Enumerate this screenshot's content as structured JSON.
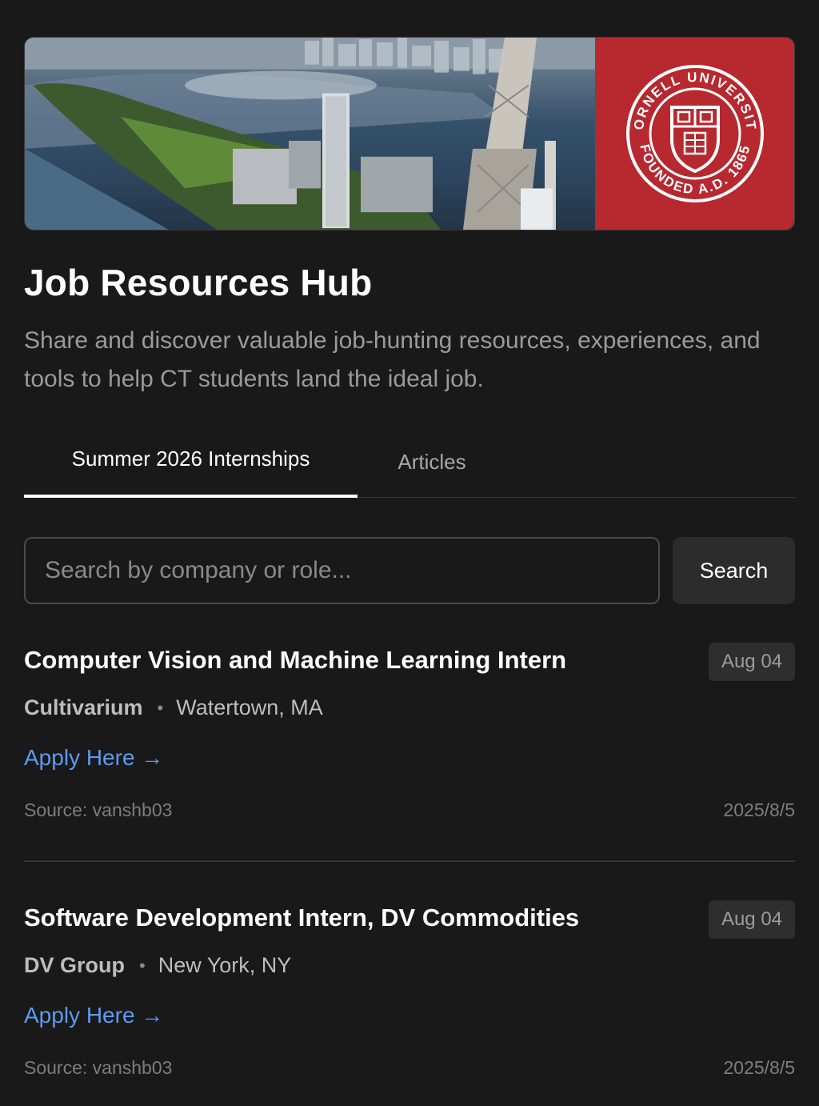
{
  "banner": {
    "seal_text_top": "CORNELL UNIVERSITY",
    "seal_text_bottom": "FOUNDED A.D. 1865",
    "seal_color": "#b7282f"
  },
  "header": {
    "title": "Job Resources Hub",
    "subtitle": "Share and discover valuable job-hunting resources, experiences, and tools to help CT students land the ideal job."
  },
  "tabs": [
    {
      "label": "Summer 2026 Internships",
      "active": true
    },
    {
      "label": "Articles",
      "active": false
    }
  ],
  "search": {
    "placeholder": "Search by company or role...",
    "value": "",
    "button_label": "Search"
  },
  "jobs": [
    {
      "title": "Computer Vision and Machine Learning Intern",
      "date_badge": "Aug 04",
      "company": "Cultivarium",
      "location": "Watertown, MA",
      "apply_label": "Apply Here →",
      "source": "Source: vanshb03",
      "posted": "2025/8/5"
    },
    {
      "title": "Software Development Intern, DV Commodities",
      "date_badge": "Aug 04",
      "company": "DV Group",
      "location": "New York, NY",
      "apply_label": "Apply Here →",
      "source": "Source: vanshb03",
      "posted": "2025/8/5"
    }
  ],
  "colors": {
    "background": "#191919",
    "accent_link": "#5d9bf0"
  }
}
